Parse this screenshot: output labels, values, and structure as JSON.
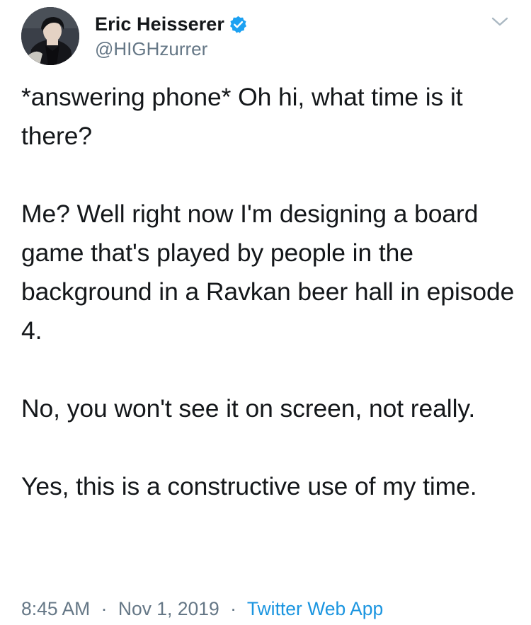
{
  "tweet": {
    "author": {
      "display_name": "Eric Heisserer",
      "handle": "@HIGHzurrer",
      "verified": true
    },
    "paragraphs": [
      "*answering phone* Oh hi, what time is it there?",
      "Me? Well right now I'm designing a board game that's played by people in the background in a Ravkan beer hall in episode 4.",
      "No, you won't see it on screen, not really.",
      "Yes, this is a constructive use of my time."
    ],
    "time": "8:45 AM",
    "date": "Nov 1, 2019",
    "separator": "·",
    "source": "Twitter Web App"
  },
  "icons": {
    "verified": "verified-badge-icon",
    "caret": "chevron-down-icon"
  },
  "colors": {
    "text": "#14171a",
    "secondary": "#657786",
    "link": "#1b95e0",
    "verified": "#1da1f2",
    "caret": "#aab8c2"
  }
}
